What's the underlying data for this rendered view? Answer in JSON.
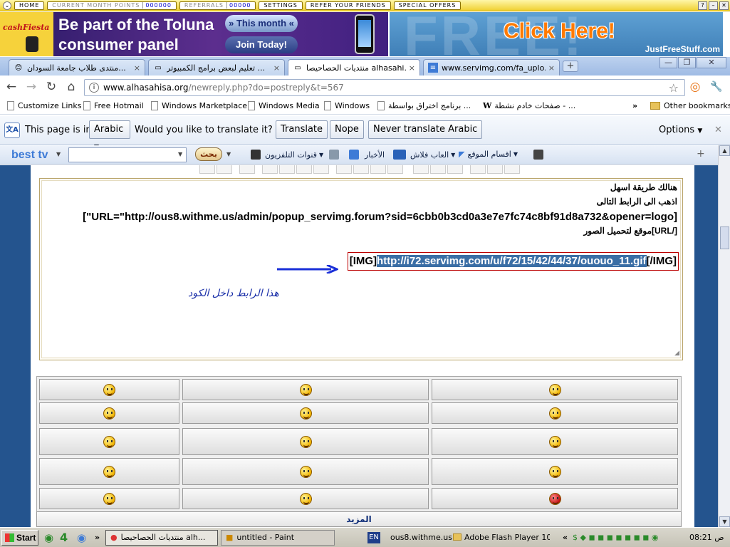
{
  "addon_bar": {
    "home": "HOME",
    "current_month_points_label": "CURRENT MONTH POINTS",
    "current_month_points_value": "000000",
    "referrals_label": "REFERRALS",
    "referrals_value": "00000",
    "settings": "SETTINGS",
    "refer_friends": "REFER YOUR FRIENDS",
    "special_offers": "SPECIAL OFFERS"
  },
  "banner": {
    "logo": "cashFiesta",
    "line1": "Be part of the Toluna",
    "line2": "consumer panel",
    "btn1": "» This month «",
    "btn2": "Join Today!",
    "free": "FREE!",
    "click": "Click Here!",
    "site": "JustFreeStuff.com"
  },
  "tabs": [
    {
      "label": "منتدى طلاب جامعة السودان...",
      "close": "×"
    },
    {
      "label": "تعليم لبعض برامج الكمبيوتر ...",
      "close": "×"
    },
    {
      "label": "منتديات الحصاحيصا alhasahi...",
      "close": "×"
    },
    {
      "label": "www.servimg.com/fa_uplo...",
      "close": "×"
    }
  ],
  "window_controls": {
    "minimize": "—",
    "restore": "❐",
    "close": "✕"
  },
  "nav": {
    "back": "←",
    "forward": "→",
    "reload": "↻",
    "home": "⌂",
    "url_host": "www.alhasahisa.org",
    "url_path": "/newreply.php?do=postreply&t=567",
    "star": "☆",
    "extras": [
      "◎",
      "🔧"
    ]
  },
  "bookmarks": [
    "Customize Links",
    "Free Hotmail",
    "Windows Marketplace",
    "Windows Media",
    "Windows",
    "برنامج اختراق بواسطة ...",
    "صفحات خادم نشطة - ...",
    "»",
    "Other bookmarks"
  ],
  "translate": {
    "prefix": "This page is in",
    "language": "Arabic",
    "question": "Would you like to translate it?",
    "translate_btn": "Translate",
    "nope_btn": "Nope",
    "never_btn": "Never translate Arabic",
    "options": "Options",
    "close": "✕"
  },
  "bestbar": {
    "logo": "best tv",
    "search_btn": "بحث",
    "items": [
      "قنوات التلفزيون",
      "الأخبار",
      "العاب فلاش",
      "اقسام الموقع"
    ]
  },
  "editor": {
    "line1": "هنالك طريقة اسهل",
    "line2": "اذهب الى الرابط التالى",
    "line3": "[\"URL=\"http://ous8.withme.us/admin/popup_servimg.forum?sid=6cbb0b3cd0a3e7e7fc74c8bf91d8a732&opener=logo]",
    "line4": "موقع لتحميل الصور[URL/]",
    "img_open": "[IMG]",
    "img_url": "http://i72.servimg.com/u/f72/15/42/44/37/ououo_11.gif",
    "img_close": "[/IMG]",
    "hint": "هذا الرابط داخل الكود"
  },
  "smilies_more": "المزيد",
  "scrollbar": {
    "up": "▲",
    "down": "▼"
  },
  "taskbar": {
    "start": "Start",
    "quick_count": "4",
    "tasks": [
      "منتديات الحصاحيصا alh...",
      "untitled - Paint"
    ],
    "lang": "EN",
    "tray_tasks": [
      "ous8.withme.us",
      "Adobe Flash Player 10.("
    ],
    "clock": "08:21 ص"
  },
  "colors": {
    "selection": "#3a6ea5",
    "arrow": "#1a2fd8",
    "page_bg": "#24548e"
  }
}
